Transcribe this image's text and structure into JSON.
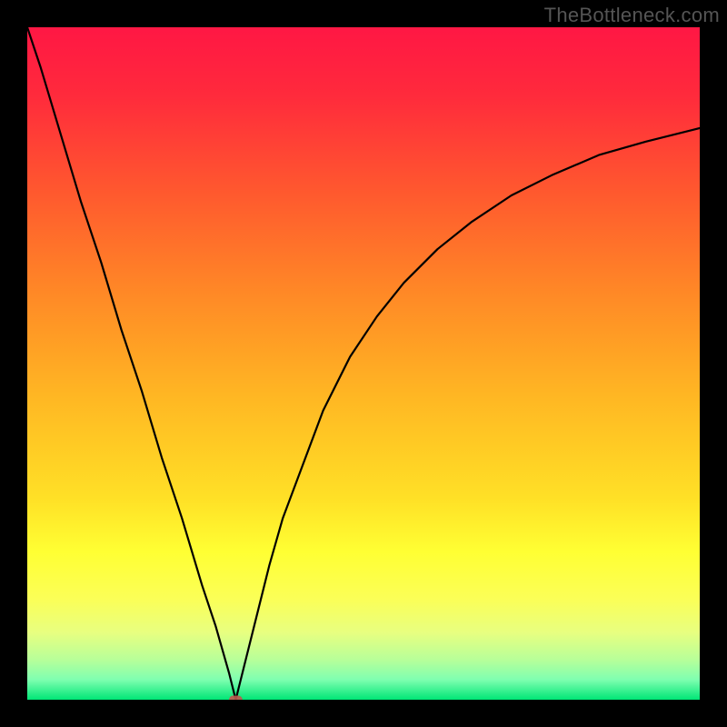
{
  "watermark": "TheBottleneck.com",
  "chart_data": {
    "type": "line",
    "title": "",
    "xlabel": "",
    "ylabel": "",
    "xlim": [
      0,
      100
    ],
    "ylim": [
      0,
      100
    ],
    "grid": false,
    "background_gradient": {
      "stops": [
        {
          "offset": 0.0,
          "color": "#ff1744"
        },
        {
          "offset": 0.1,
          "color": "#ff2a3c"
        },
        {
          "offset": 0.25,
          "color": "#ff5a2e"
        },
        {
          "offset": 0.4,
          "color": "#ff8a26"
        },
        {
          "offset": 0.55,
          "color": "#ffb723"
        },
        {
          "offset": 0.7,
          "color": "#ffe026"
        },
        {
          "offset": 0.78,
          "color": "#ffff33"
        },
        {
          "offset": 0.85,
          "color": "#fbff57"
        },
        {
          "offset": 0.9,
          "color": "#e8ff80"
        },
        {
          "offset": 0.94,
          "color": "#b8ff99"
        },
        {
          "offset": 0.97,
          "color": "#7fffb0"
        },
        {
          "offset": 1.0,
          "color": "#00e676"
        }
      ]
    },
    "series": [
      {
        "name": "left-branch",
        "type": "line",
        "color": "#000000",
        "x": [
          0,
          2,
          5,
          8,
          11,
          14,
          17,
          20,
          23,
          26,
          28,
          30,
          31
        ],
        "y": [
          100,
          94,
          84,
          74,
          65,
          55,
          46,
          36,
          27,
          17,
          11,
          4,
          0
        ]
      },
      {
        "name": "right-branch",
        "type": "line",
        "color": "#000000",
        "x": [
          31,
          32,
          34,
          36,
          38,
          41,
          44,
          48,
          52,
          56,
          61,
          66,
          72,
          78,
          85,
          92,
          100
        ],
        "y": [
          0,
          4,
          12,
          20,
          27,
          35,
          43,
          51,
          57,
          62,
          67,
          71,
          75,
          78,
          81,
          83,
          85
        ]
      }
    ],
    "markers": [
      {
        "name": "vertex-marker",
        "shape": "rounded-rect",
        "x": 31,
        "y": 0,
        "width": 2.0,
        "height": 1.2,
        "fill": "#c0584f",
        "opacity": 0.9
      }
    ]
  }
}
